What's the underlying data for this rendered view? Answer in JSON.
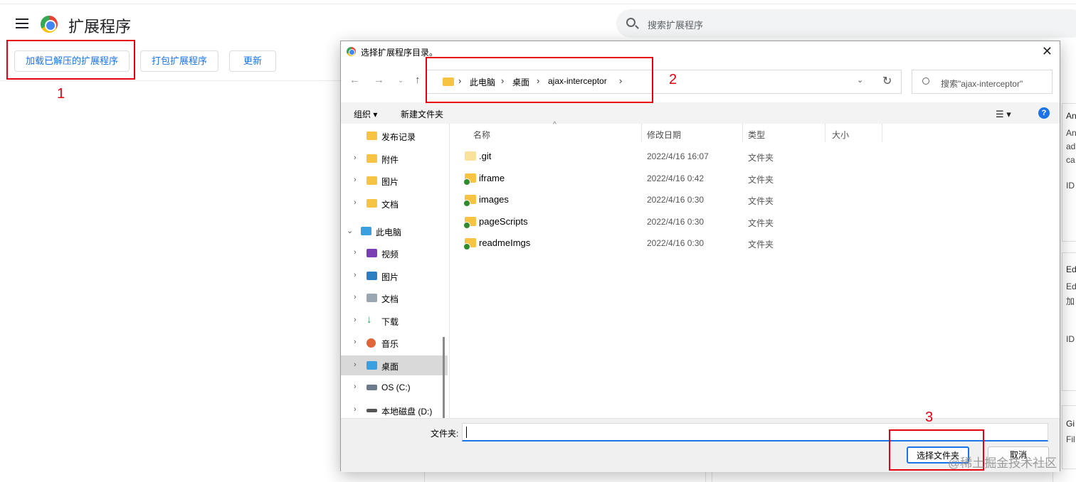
{
  "app": {
    "title": "扩展程序"
  },
  "search": {
    "placeholder": "搜索扩展程序"
  },
  "toolbar": {
    "load_unpacked": "加载已解压的扩展程序",
    "pack": "打包扩展程序",
    "update": "更新"
  },
  "annotations": [
    "1",
    "2",
    "3"
  ],
  "background_cards": [
    {
      "title": "An",
      "lines": [
        "An",
        "ad",
        "ca",
        "ID"
      ]
    },
    {
      "title": "Ed",
      "lines": [
        "Ed",
        "加",
        "ID"
      ]
    },
    {
      "title": "Gi",
      "lines": [
        "Fil"
      ]
    }
  ],
  "dialog": {
    "title": "选择扩展程序目录。",
    "close": "✕",
    "breadcrumb": [
      "此电脑",
      "桌面",
      "ajax-interceptor"
    ],
    "search_placeholder": "搜索\"ajax-interceptor\"",
    "commands": {
      "organize": "组织 ▾",
      "new_folder": "新建文件夹"
    },
    "nav_tree": [
      {
        "label": "发布记录",
        "icon": "folder-icon",
        "has_chevron": false,
        "selected": false
      },
      {
        "label": "附件",
        "icon": "folder-icon",
        "has_chevron": true,
        "selected": false
      },
      {
        "label": "图片",
        "icon": "folder-icon",
        "has_chevron": true,
        "selected": false
      },
      {
        "label": "文档",
        "icon": "folder-icon",
        "has_chevron": true,
        "selected": false
      },
      {
        "label": "此电脑",
        "icon": "computer-icon",
        "has_chevron": true,
        "expanded": true,
        "selected": false
      },
      {
        "label": "视频",
        "icon": "video-icon",
        "has_chevron": true,
        "selected": false
      },
      {
        "label": "图片",
        "icon": "pictures-icon",
        "has_chevron": true,
        "selected": false
      },
      {
        "label": "文档",
        "icon": "documents-icon",
        "has_chevron": true,
        "selected": false
      },
      {
        "label": "下载",
        "icon": "download-icon",
        "has_chevron": true,
        "selected": false
      },
      {
        "label": "音乐",
        "icon": "music-icon",
        "has_chevron": true,
        "selected": false
      },
      {
        "label": "桌面",
        "icon": "desktop-icon",
        "has_chevron": true,
        "selected": true
      },
      {
        "label": "OS (C:)",
        "icon": "drive-icon",
        "has_chevron": true,
        "selected": false
      },
      {
        "label": "本地磁盘 (D:)",
        "icon": "disk-icon",
        "has_chevron": true,
        "selected": false
      }
    ],
    "columns": {
      "name": "名称",
      "modified": "修改日期",
      "type": "类型",
      "size": "大小"
    },
    "files": [
      {
        "name": ".git",
        "modified": "2022/4/16 16:07",
        "type": "文件夹",
        "synced": false
      },
      {
        "name": "iframe",
        "modified": "2022/4/16 0:42",
        "type": "文件夹",
        "synced": true
      },
      {
        "name": "images",
        "modified": "2022/4/16 0:30",
        "type": "文件夹",
        "synced": true
      },
      {
        "name": "pageScripts",
        "modified": "2022/4/16 0:30",
        "type": "文件夹",
        "synced": true
      },
      {
        "name": "readmeImgs",
        "modified": "2022/4/16 0:30",
        "type": "文件夹",
        "synced": true
      }
    ],
    "folder_label": "文件夹:",
    "folder_value": "",
    "select_button": "选择文件夹",
    "cancel_button": "取消"
  },
  "watermark": "@稀土掘金技术社区",
  "colors": {
    "accent": "#1a73e8",
    "annotation": "#e60012",
    "folder": "#f6c342"
  }
}
